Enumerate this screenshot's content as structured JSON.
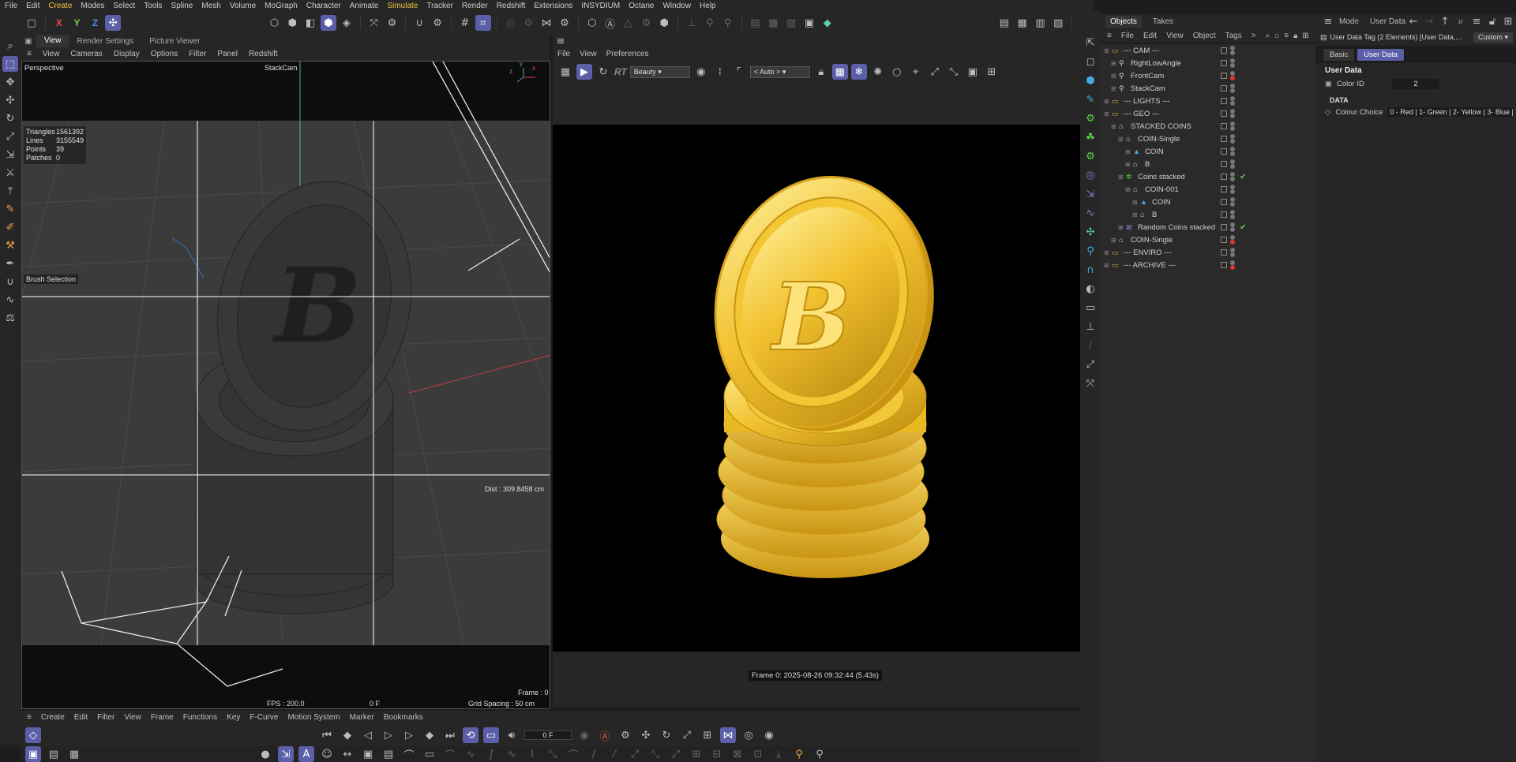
{
  "menubar": [
    "File",
    "Edit",
    "Create",
    "Modes",
    "Select",
    "Tools",
    "Spline",
    "Mesh",
    "Volume",
    "MoGraph",
    "Character",
    "Animate",
    "Simulate",
    "Tracker",
    "Render",
    "Redshift",
    "Extensions",
    "INSYDIUM",
    "Octane",
    "Window",
    "Help"
  ],
  "highlighted_menus": [
    "Create",
    "Simulate"
  ],
  "toolbar": {
    "axis_x": "X",
    "axis_y": "Y",
    "axis_z": "Z"
  },
  "viewport": {
    "tabs": [
      "View",
      "Render Settings",
      "Picture Viewer"
    ],
    "menu": [
      "View",
      "Cameras",
      "Display",
      "Options",
      "Filter",
      "Panel",
      "Redshift"
    ],
    "camera_mode": "Perspective",
    "camera_name": "StackCam",
    "stats": [
      {
        "label": "Triangles",
        "value": "1561392"
      },
      {
        "label": "Lines",
        "value": "3155549"
      },
      {
        "label": "Points",
        "value": "39"
      },
      {
        "label": "Patches",
        "value": "0"
      }
    ],
    "brush_label": "Brush Selection",
    "dist": "Dist : 309.8458 cm",
    "frame": "Frame : 0",
    "fps": "FPS : 200.0",
    "frame_f": "0 F",
    "grid_spacing": "Grid Spacing : 50 cm"
  },
  "render_view": {
    "menu": [
      "File",
      "View",
      "Preferences"
    ],
    "rt": "RT",
    "pass": "Beauty",
    "auto": "< Auto >",
    "status": "Frame  0:  2025-08-26  09:32:44  (5.43s)"
  },
  "timeline": {
    "menu": [
      "Create",
      "Edit",
      "Filter",
      "View",
      "Frame",
      "Functions",
      "Key",
      "F-Curve",
      "Motion System",
      "Marker",
      "Bookmarks"
    ],
    "frame_field": "0 F"
  },
  "object_manager": {
    "tabs": [
      "Objects",
      "Takes"
    ],
    "menu": [
      "File",
      "Edit",
      "View",
      "Object",
      "Tags"
    ],
    "more": ">",
    "rows": [
      {
        "name": "--- CAM ---",
        "indent": 0,
        "icon": "folder-icon",
        "dot": "#777",
        "check": false
      },
      {
        "name": "RightLowAngle",
        "indent": 1,
        "icon": "camera-icon",
        "dot": "#777",
        "check": false
      },
      {
        "name": "FrontCam",
        "indent": 1,
        "icon": "camera-icon",
        "dot": "#d33",
        "check": false
      },
      {
        "name": "StackCam",
        "indent": 1,
        "icon": "camera-icon",
        "dot": "#777",
        "check": false
      },
      {
        "name": "--- LIGHTS ---",
        "indent": 0,
        "icon": "folder-icon",
        "dot": "#777",
        "check": false
      },
      {
        "name": "--- GEO ---",
        "indent": 0,
        "icon": "folder-icon",
        "dot": "#777",
        "check": false
      },
      {
        "name": "STACKED COINS",
        "indent": 1,
        "icon": "null-icon",
        "dot": "#777",
        "check": false
      },
      {
        "name": "COIN-Single",
        "indent": 2,
        "icon": "null-icon",
        "dot": "#777",
        "check": false
      },
      {
        "name": "COIN",
        "indent": 3,
        "icon": "mesh-icon",
        "dot": "#777",
        "check": false
      },
      {
        "name": "B",
        "indent": 3,
        "icon": "null-icon",
        "dot": "#777",
        "check": false
      },
      {
        "name": "Coins stacked",
        "indent": 2,
        "icon": "cloner-icon",
        "dot": "#777",
        "check": true
      },
      {
        "name": "COIN-001",
        "indent": 3,
        "icon": "null-icon",
        "dot": "#777",
        "check": false
      },
      {
        "name": "COIN",
        "indent": 4,
        "icon": "mesh-icon",
        "dot": "#777",
        "check": false
      },
      {
        "name": "B",
        "indent": 4,
        "icon": "null-icon",
        "dot": "#777",
        "check": false
      },
      {
        "name": "Random Coins stacked",
        "indent": 2,
        "icon": "effector-icon",
        "dot": "#777",
        "check": true
      },
      {
        "name": "COIN-Single",
        "indent": 1,
        "icon": "null-icon",
        "dot": "#d33",
        "check": false
      },
      {
        "name": "--- ENVIRO ---",
        "indent": 0,
        "icon": "folder-icon",
        "dot": "#777",
        "check": false
      },
      {
        "name": "--- ARCHIVE ---",
        "indent": 0,
        "icon": "folder-icon",
        "dot": "#d33",
        "check": false
      }
    ]
  },
  "attribute_manager": {
    "header_mode": "Mode",
    "header_userdata": "User Data",
    "subtitle": "User Data Tag (2 Elements) [User Data,...",
    "custom": "Custom",
    "tabs": [
      "Basic",
      "User Data"
    ],
    "section": "User Data",
    "color_id_label": "Color ID",
    "color_id_value": "2",
    "data_label": "DATA",
    "colour_choice_label": "Colour Choice",
    "colour_choice_value": "0 - Red | 1- Green | 2- Yellow | 3- Blue |"
  },
  "colors": {
    "accent": "#5b5fa8",
    "highlight_menu": "#f0c040",
    "gold": "#e8b820",
    "red_dot": "#d33"
  }
}
